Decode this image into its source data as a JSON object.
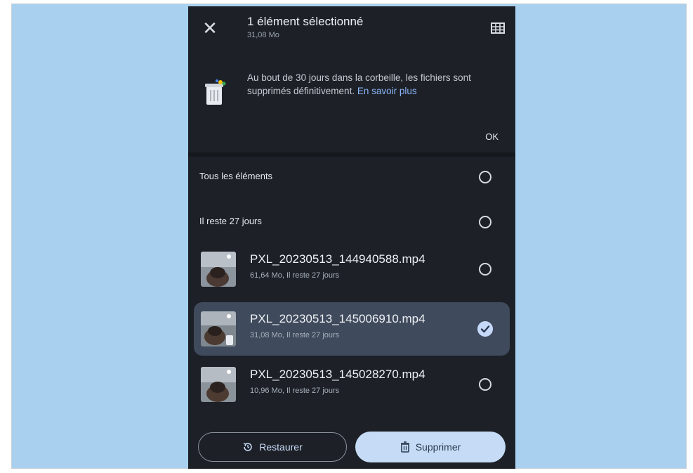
{
  "header": {
    "title": "1 élément sélectionné",
    "subtitle": "31,08 Mo"
  },
  "banner": {
    "text": "Au bout de 30 jours dans la corbeille, les fichiers sont supprimés définitivement.",
    "link": "En savoir plus",
    "ok_label": "OK"
  },
  "sections": {
    "all_items": "Tous les éléments",
    "group": "Il reste 27 jours"
  },
  "files": [
    {
      "name": "PXL_20230513_144940588.mp4",
      "meta": "61,64 Mo, Il reste 27 jours",
      "selected": false
    },
    {
      "name": "PXL_20230513_145006910.mp4",
      "meta": "31,08 Mo, Il reste 27 jours",
      "selected": true
    },
    {
      "name": "PXL_20230513_145028270.mp4",
      "meta": "10,96 Mo, Il reste 27 jours",
      "selected": false
    }
  ],
  "actions": {
    "restore_label": "Restaurer",
    "delete_label": "Supprimer"
  },
  "colors": {
    "background": "#a9d0ee",
    "surface": "#1d2127",
    "selected_row": "#3f4a5c",
    "accent": "#c6dcf6",
    "link": "#8ab4f8"
  }
}
